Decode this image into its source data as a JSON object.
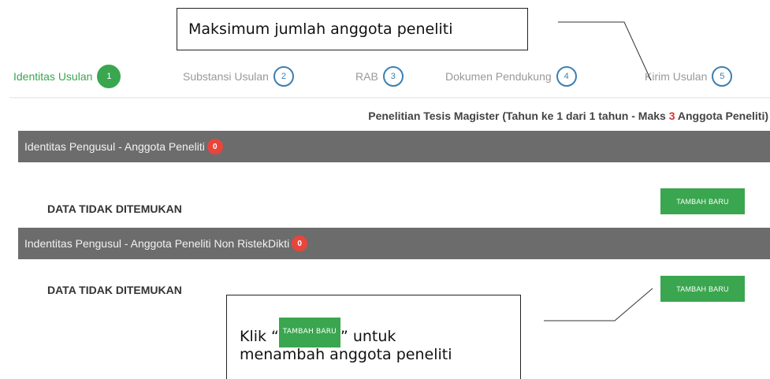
{
  "callouts": {
    "top_text": "Maksimum jumlah anggota peneliti",
    "bottom_prefix": "Klik “",
    "bottom_button_label": "TAMBAH BARU",
    "bottom_suffix": "” untuk",
    "bottom_line2": "menambah anggota peneliti"
  },
  "tabs": [
    {
      "label": "Identitas Usulan",
      "number": "1",
      "active": true
    },
    {
      "label": "Substansi Usulan",
      "number": "2",
      "active": false
    },
    {
      "label": "RAB",
      "number": "3",
      "active": false
    },
    {
      "label": "Dokumen Pendukung",
      "number": "4",
      "active": false
    },
    {
      "label": "Kirim Usulan",
      "number": "5",
      "active": false
    }
  ],
  "program_info": {
    "prefix": "Penelitian Tesis Magister (Tahun ke 1 dari 1 tahun - Maks ",
    "max_members": "3",
    "suffix": " Anggota Peneliti)"
  },
  "panels": [
    {
      "title": "Identitas Pengusul - Anggota Peneliti",
      "count": "0",
      "empty_text": "DATA TIDAK DITEMUKAN",
      "button_label": "TAMBAH BARU"
    },
    {
      "title": "Indentitas Pengusul - Anggota Peneliti Non RistekDikti",
      "count": "0",
      "empty_text": "DATA TIDAK DITEMUKAN",
      "button_label": "TAMBAH BARU"
    }
  ],
  "colors": {
    "accent_green": "#3aa64f",
    "step_blue": "#3d7fb0",
    "header_gray": "#6c6c6c",
    "badge_red": "#e8453c",
    "highlight_red": "#d9332e"
  }
}
